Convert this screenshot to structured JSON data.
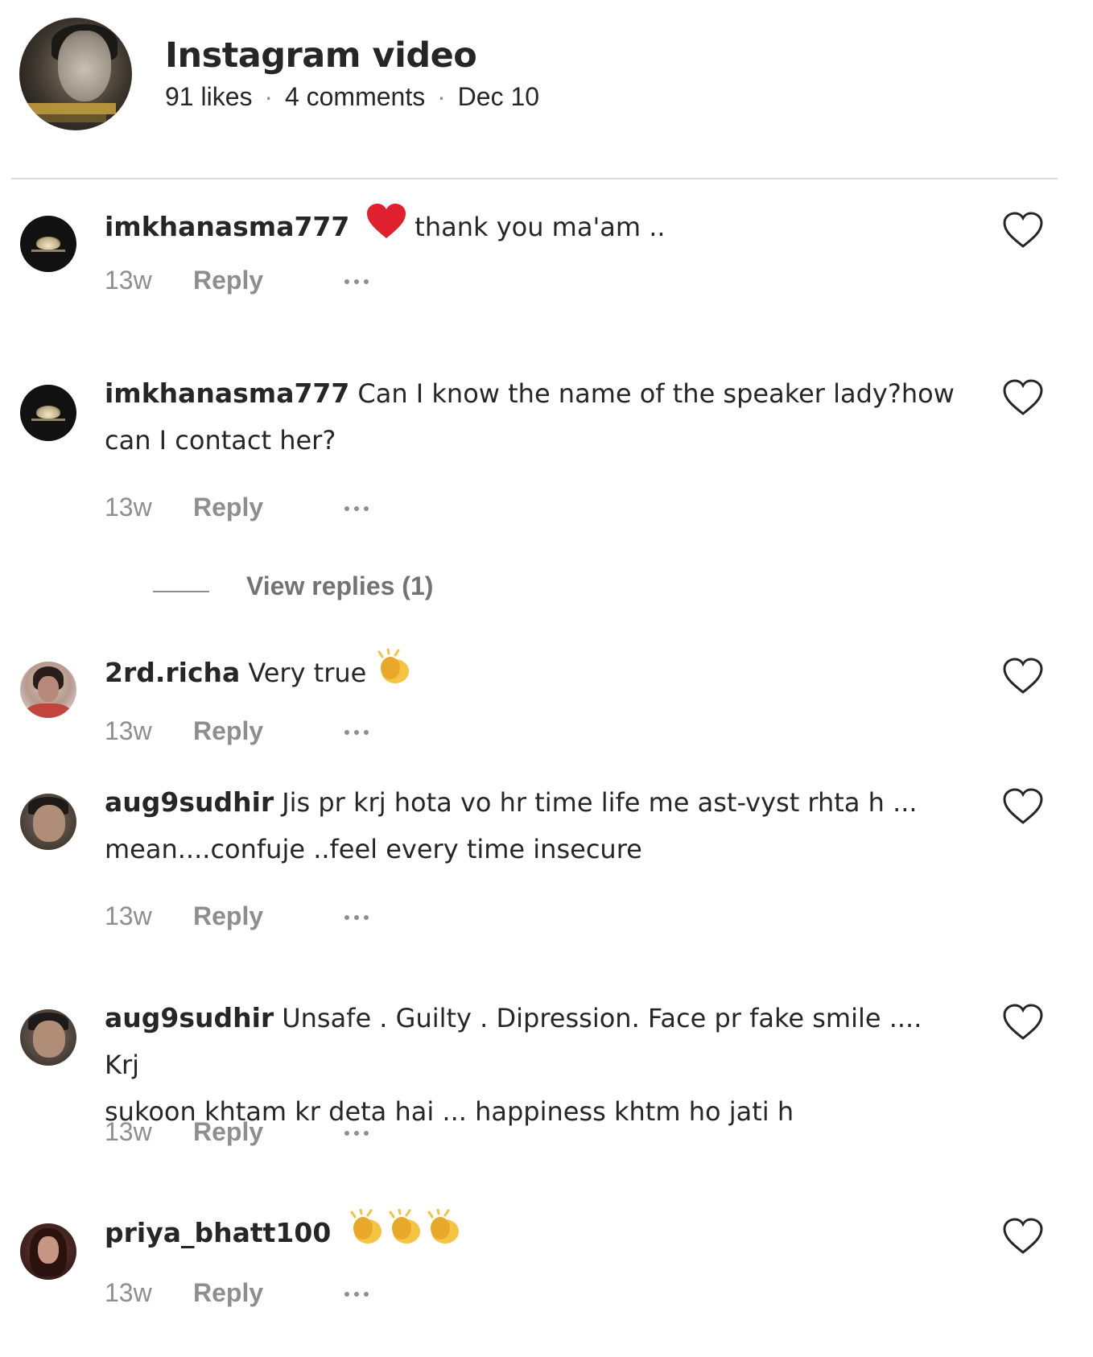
{
  "header": {
    "title": "Instagram video",
    "likes": "91 likes",
    "comments": "4 comments",
    "date": "Dec 10",
    "separator": "·"
  },
  "comments": [
    {
      "username": "imkhanasma777",
      "text_line1": "thank you ma'am ..",
      "text_line2": "",
      "emoji": "red-heart",
      "time": "13w",
      "reply": "Reply"
    },
    {
      "username": "imkhanasma777",
      "text_line1": "Can I know the name of the speaker lady?how",
      "text_line2": "can I contact her?",
      "time": "13w",
      "reply": "Reply",
      "view_replies": "View replies (1)"
    },
    {
      "username": "2rd.richa",
      "text_line1": "Very true",
      "text_line2": "",
      "emoji": "clapping-hands",
      "time": "13w",
      "reply": "Reply"
    },
    {
      "username": "aug9sudhir",
      "text_line1": "Jis pr krj hota vo hr time life me ast-vyst rhta h ...",
      "text_line2": "mean....confuje ..feel every time insecure",
      "time": "13w",
      "reply": "Reply"
    },
    {
      "username": "aug9sudhir",
      "text_line1": "Unsafe . Guilty . Dipression. Face pr fake smile .... Krj",
      "text_line2": "sukoon khtam kr deta hai ... happiness khtm ho jati h",
      "time": "13w",
      "reply": "Reply"
    },
    {
      "username": "priya_bhatt100",
      "text_line1": "",
      "text_line2": "",
      "emoji": "clapping-hands x3",
      "time": "13w",
      "reply": "Reply"
    }
  ],
  "colors": {
    "text": "#262626",
    "secondary": "#8e8e8e",
    "divider": "#dbdbdb",
    "heart_emoji": "#e0202f",
    "clap_emoji": "#f5c342"
  }
}
